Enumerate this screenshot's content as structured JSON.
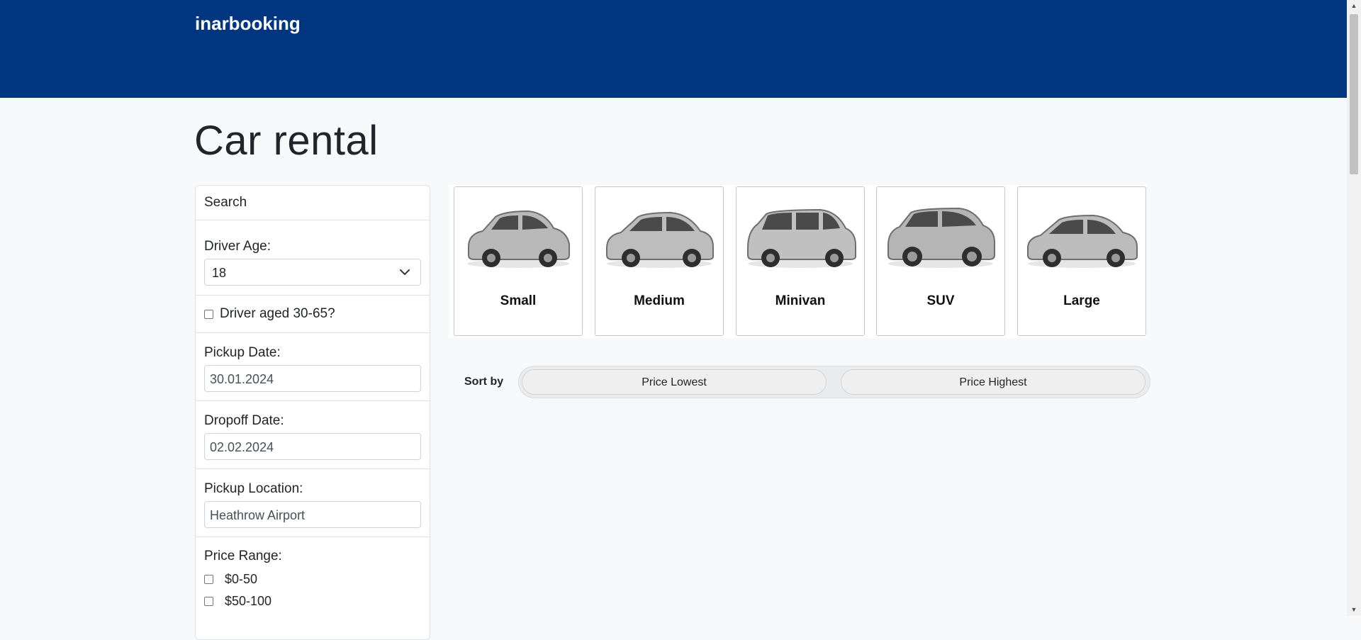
{
  "header": {
    "brand": "inarbooking"
  },
  "page": {
    "title": "Car rental"
  },
  "sidebar": {
    "title": "Search",
    "driver_age": {
      "label": "Driver Age:",
      "value": "18"
    },
    "driver_aged": {
      "label": "Driver aged 30-65?",
      "checked": false
    },
    "pickup_date": {
      "label": "Pickup Date:",
      "value": "30.01.2024"
    },
    "dropoff_date": {
      "label": "Dropoff Date:",
      "value": "02.02.2024"
    },
    "pickup_location": {
      "label": "Pickup Location:",
      "value": "Heathrow Airport"
    },
    "price_range": {
      "label": "Price Range:",
      "options": [
        {
          "label": "$0-50",
          "checked": false
        },
        {
          "label": "$50-100",
          "checked": false
        }
      ]
    }
  },
  "car_types": [
    {
      "name": "Small"
    },
    {
      "name": "Medium"
    },
    {
      "name": "Minivan"
    },
    {
      "name": "SUV"
    },
    {
      "name": "Large"
    }
  ],
  "sort": {
    "label": "Sort by",
    "options": [
      "Price Lowest",
      "Price Highest"
    ]
  },
  "colors": {
    "header_bg": "#003580",
    "page_bg": "#f8f9fa"
  }
}
